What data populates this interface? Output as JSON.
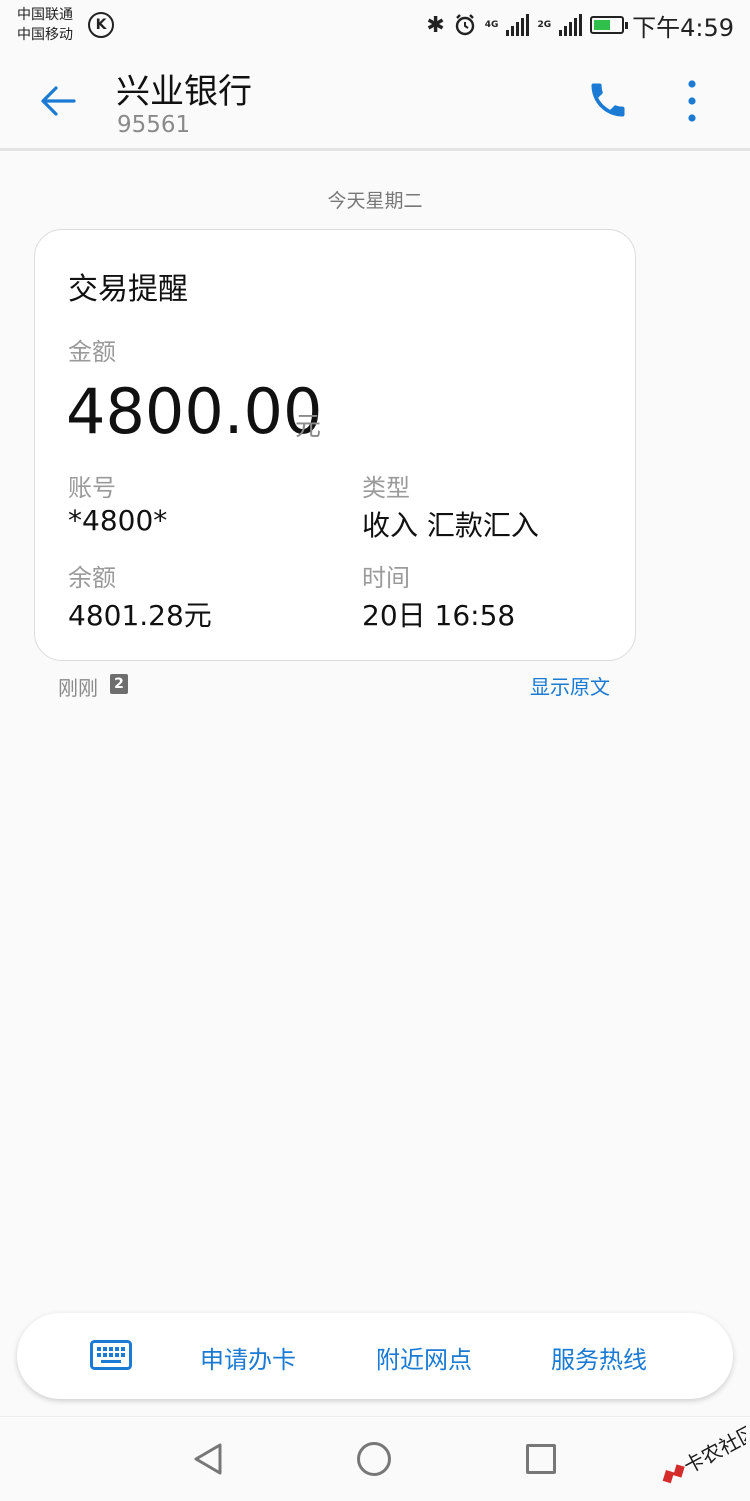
{
  "status_bar": {
    "carrier_1": "中国联通",
    "carrier_2": "中国移动",
    "k_badge": "K",
    "net_1": "4G",
    "net_2": "2G",
    "time": "下午4:59",
    "icons": [
      "bluetooth-icon",
      "alarm-icon",
      "signal-icon",
      "battery-charging-icon"
    ],
    "battery_level": 0.6
  },
  "header": {
    "title": "兴业银行",
    "subtitle": "95561",
    "icons": [
      "back-arrow-icon",
      "phone-icon",
      "more-vert-icon"
    ],
    "accent_color": "#1a7ad4"
  },
  "date_separator": "今天星期二",
  "message": {
    "title": "交易提醒",
    "amount_label": "金额",
    "amount": "4800.00",
    "amount_unit": "元",
    "account_label": "账号",
    "account": "*4800*",
    "type_label": "类型",
    "type": "收入 汇款汇入",
    "balance_label": "余额",
    "balance": "4801.28元",
    "time_label": "时间",
    "time": "20日 16:58",
    "sent_time": "刚刚",
    "sim_badge": "2",
    "show_original": "显示原文"
  },
  "quick_menu": {
    "keyboard_icon": "keyboard-icon",
    "items": [
      "申请办卡",
      "附近网点",
      "服务热线"
    ]
  },
  "nav_bar": {
    "icons": [
      "nav-back-icon",
      "nav-home-icon",
      "nav-recents-icon"
    ]
  },
  "watermark": {
    "text": "卡农社区"
  }
}
